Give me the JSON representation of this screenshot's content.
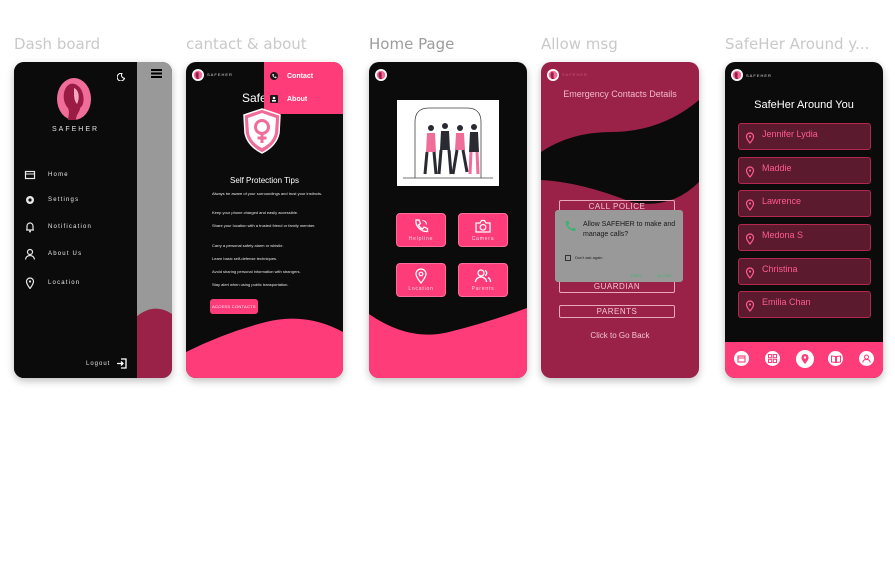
{
  "frames": [
    {
      "title": "Dash board"
    },
    {
      "title": "cantact & about"
    },
    {
      "title": "Home Page"
    },
    {
      "title": "Allow msg"
    },
    {
      "title": "SafeHer Around y..."
    }
  ],
  "dashboard": {
    "brand": "SAFEHER",
    "menu": [
      "Home",
      "Settings",
      "Notification",
      "About Us",
      "Location"
    ],
    "logout": "Logout"
  },
  "contact_about": {
    "brand_small": "SAFEHER",
    "dropdown": [
      "Contact",
      "About"
    ],
    "heading_partial": "Safe",
    "tips_title": "Self Protection Tips",
    "tips": [
      "Always be aware of your surroundings and trust your instincts.",
      "Keep your phone charged and easily accessible.",
      "Share your location with a trusted friend or family member.",
      "Carry a personal safety alarm or whistle.",
      "Learn basic self-defense techniques.",
      "Avoid sharing personal information with strangers.",
      "Stay alert when using public transportation."
    ],
    "button": "ACCESS CONTACTS"
  },
  "home": {
    "buttons": [
      "Helpline",
      "Camera",
      "Location",
      "Parents"
    ]
  },
  "allow": {
    "brand_small": "SAFEHER",
    "header": "Emergency Contacts Details",
    "options": [
      "CALL POLICE",
      "GUARDIAN",
      "PARENTS"
    ],
    "dialog_text": "Allow SAFEHER to make and manage calls?",
    "dialog_check": "Don't ask again",
    "deny": "DENY",
    "allow": "ALLOW",
    "back": "Click to Go Back"
  },
  "around": {
    "brand_small": "SAFEHER",
    "title": "SafeHer Around You",
    "contacts": [
      "Jennifer Lydia",
      "Maddie",
      "Lawrence",
      "Medona S",
      "Christina",
      "Emilia Chan"
    ]
  },
  "colors": {
    "accent": "#ff3c7a",
    "dark": "#0b0b0c",
    "maroon": "#9a2248"
  }
}
